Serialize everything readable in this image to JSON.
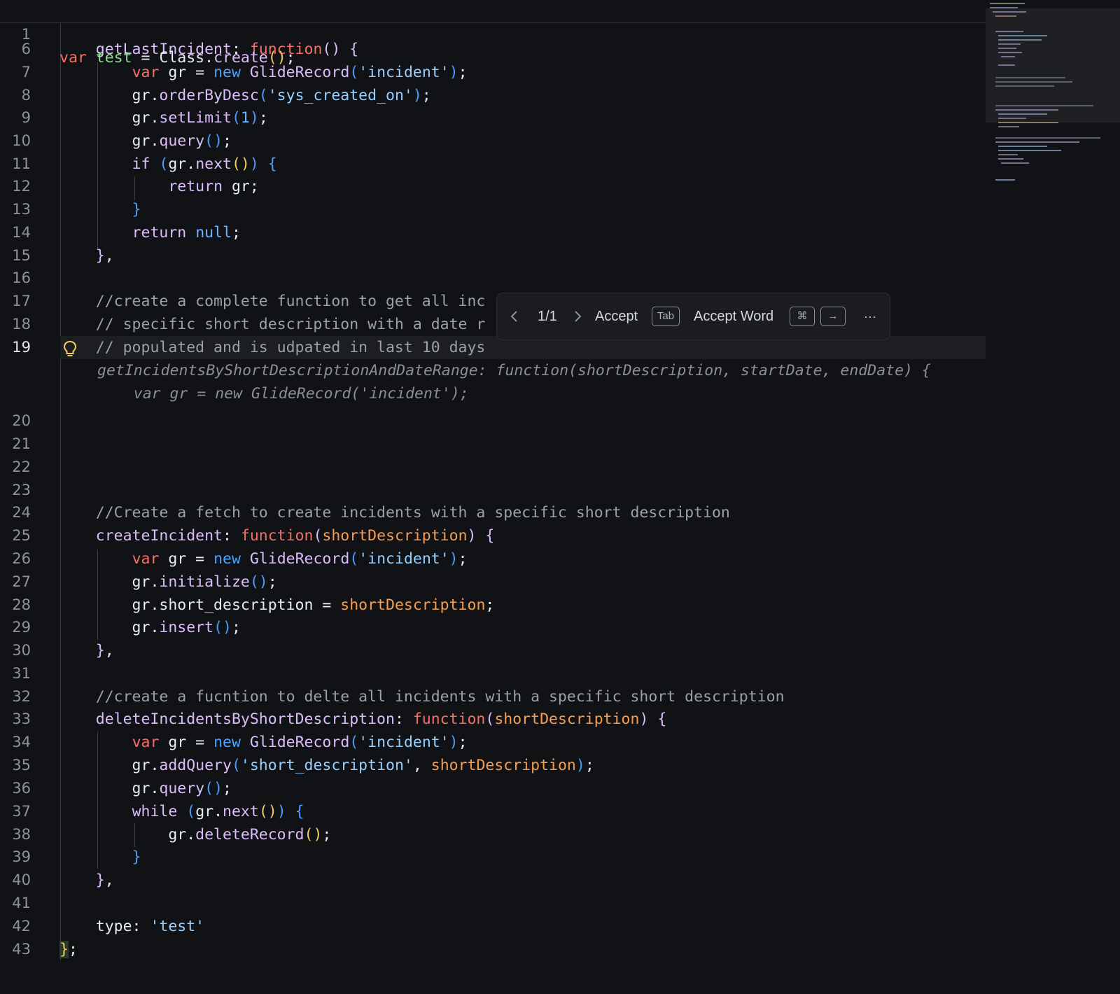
{
  "editor": {
    "sticky_line": {
      "number": "1",
      "text": "var test = Class.create();"
    },
    "ghost_lines": [
      "getIncidentsByShortDescriptionAndDateRange: function(shortDescription, startDate, endDate) {",
      "    var gr = new GlideRecord('incident');"
    ],
    "active_line": "19"
  },
  "suggestion_toolbar": {
    "prev_icon": "chevron-left-icon",
    "counter": "1/1",
    "next_icon": "chevron-right-icon",
    "accept_label": "Accept",
    "accept_key": "Tab",
    "accept_word_label": "Accept Word",
    "accept_word_key1": "⌘",
    "accept_word_key2": "→",
    "more_icon": "ellipsis-icon",
    "more_label": "···"
  },
  "colors": {
    "background": "#111215",
    "keyword": "#f47067",
    "function_name": "#dcbdfb",
    "string": "#96d0ff",
    "comment": "#9aa1ab",
    "parameter": "#f69d50"
  }
}
